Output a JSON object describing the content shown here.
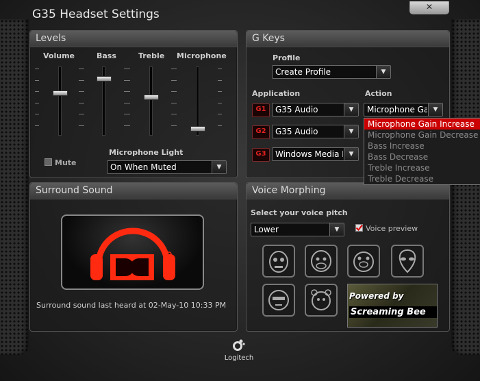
{
  "window": {
    "title": "G35 Headset Settings",
    "close_glyph": "✕"
  },
  "levels": {
    "title": "Levels",
    "sliders": [
      {
        "label": "Volume",
        "value_pct": 62
      },
      {
        "label": "Bass",
        "value_pct": 85
      },
      {
        "label": "Treble",
        "value_pct": 55
      },
      {
        "label": "Microphone",
        "value_pct": 4
      }
    ],
    "mute_label": "Mute",
    "mute_checked": false,
    "mic_light_label": "Microphone Light",
    "mic_light_value": "On When Muted"
  },
  "gkeys": {
    "title": "G Keys",
    "profile_label": "Profile",
    "profile_value": "Create Profile",
    "application_label": "Application",
    "action_label": "Action",
    "rows": [
      {
        "key": "G1",
        "application": "G35 Audio",
        "action": "Microphone Gain Increase"
      },
      {
        "key": "G2",
        "application": "G35 Audio",
        "action": ""
      },
      {
        "key": "G3",
        "application": "Windows Media Player",
        "action": ""
      }
    ],
    "action_options": [
      "Microphone Gain Increase",
      "Microphone Gain Decrease",
      "Bass Increase",
      "Bass Decrease",
      "Treble Increase",
      "Treble Decrease"
    ],
    "selected_option_index": 0
  },
  "surround": {
    "title": "Surround Sound",
    "status_text": "Surround sound last heard at 02-May-10 10:33 PM"
  },
  "voice": {
    "title": "Voice Morphing",
    "pitch_label": "Select your voice pitch",
    "pitch_value": "Lower",
    "preview_label": "Voice preview",
    "preview_checked": true,
    "powered_by": "Powered by",
    "brand": "Screaming Bee"
  },
  "footer": {
    "logo_text": "Logitech"
  },
  "colors": {
    "accent_red": "#e01010",
    "selected_red": "#cc0000",
    "panel_border": "#555555"
  }
}
